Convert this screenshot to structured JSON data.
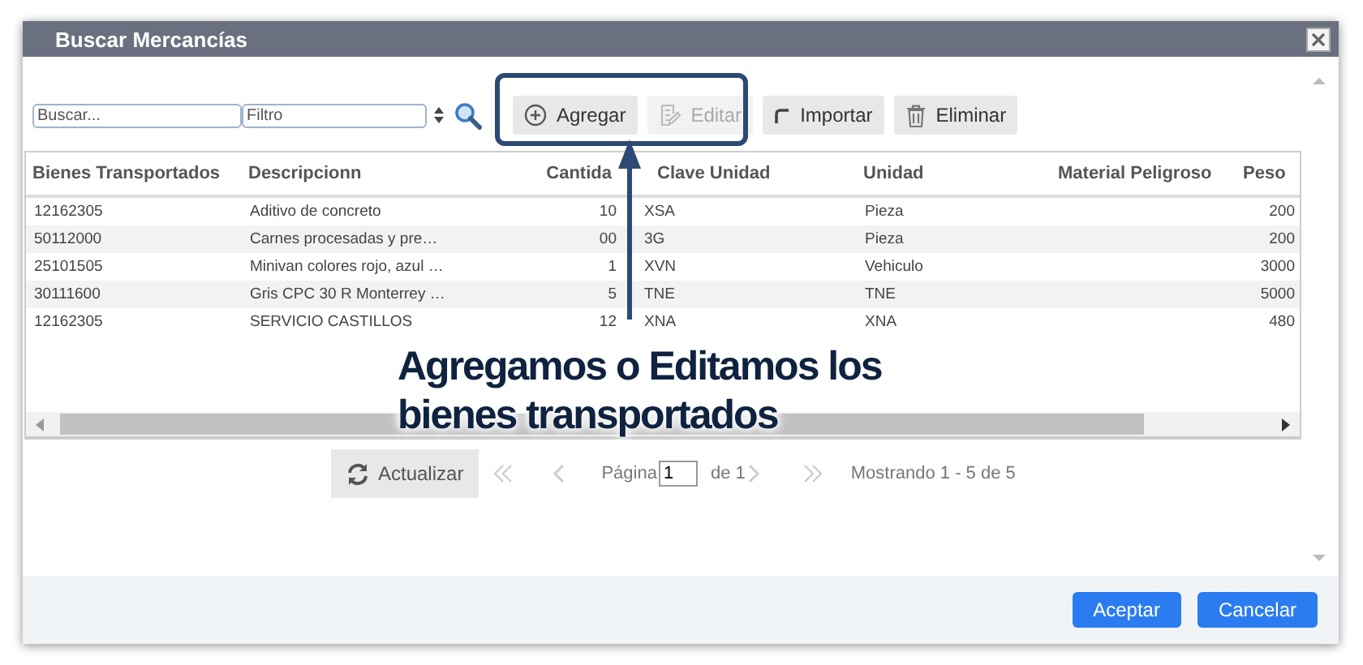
{
  "window": {
    "title": "Buscar Mercancías"
  },
  "toolbar": {
    "search": {
      "placeholder": "Buscar..."
    },
    "filter": {
      "placeholder": "Filtro"
    },
    "buttons": [
      {
        "label": "Agregar",
        "kind": "add",
        "disabled": false
      },
      {
        "label": "Editar",
        "kind": "edit",
        "disabled": true
      },
      {
        "label": "Importar",
        "kind": "import",
        "disabled": false
      },
      {
        "label": "Eliminar",
        "kind": "delete",
        "disabled": false
      }
    ]
  },
  "table": {
    "columns": [
      "Bienes Transportados",
      "Descripcionn",
      "Cantida",
      "Clave Unidad",
      "Unidad",
      "Material Peligroso",
      "Peso"
    ],
    "rows": [
      [
        "12162305",
        "Aditivo de concreto",
        "10",
        "XSA",
        "Pieza",
        null,
        "200"
      ],
      [
        "50112000",
        "Carnes procesadas y pre…",
        "00",
        "3G",
        "Pieza",
        null,
        "200"
      ],
      [
        "25101505",
        "Minivan colores rojo, azul …",
        "1",
        "XVN",
        "Vehiculo",
        null,
        "3000"
      ],
      [
        "30111600",
        "Gris CPC 30 R Monterrey …",
        "5",
        "TNE",
        "TNE",
        null,
        "5000"
      ],
      [
        "12162305",
        "SERVICIO CASTILLOS",
        "12",
        "XNA",
        "XNA",
        null,
        "480"
      ]
    ]
  },
  "pager": {
    "refresh": "Actualizar",
    "page_label": "Página",
    "page": "1",
    "of": "de 1",
    "summary": "Mostrando 1 - 5 de 5"
  },
  "footer_buttons": [
    {
      "label": "Aceptar"
    },
    {
      "label": "Cancelar"
    }
  ],
  "annotation": {
    "text": "Agregamos o Editamos los bienes transportados"
  }
}
